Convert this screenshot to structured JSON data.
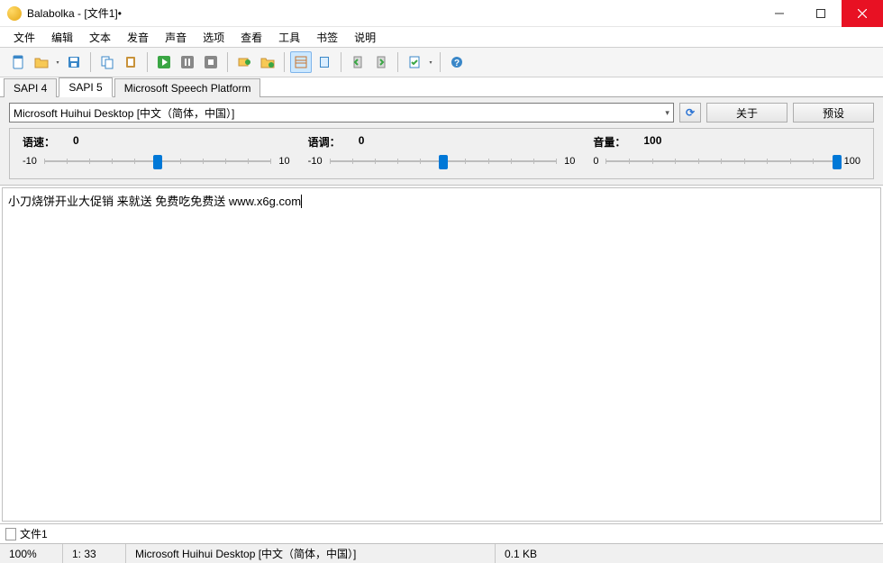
{
  "window": {
    "title": "Balabolka - [文件1]•"
  },
  "menu": [
    "文件",
    "编辑",
    "文本",
    "发音",
    "声音",
    "选项",
    "查看",
    "工具",
    "书签",
    "说明"
  ],
  "tabs": {
    "items": [
      "SAPI 4",
      "SAPI 5",
      "Microsoft Speech Platform"
    ],
    "active": 1
  },
  "voice": {
    "selected": "Microsoft Huihui Desktop [中文（简体，中国）]",
    "about_btn": "关于",
    "preset_btn": "预设"
  },
  "sliders": {
    "rate": {
      "label": "语速：",
      "value": "0",
      "min": "-10",
      "max": "10",
      "pos": 50
    },
    "pitch": {
      "label": "语调：",
      "value": "0",
      "min": "-10",
      "max": "10",
      "pos": 50
    },
    "volume": {
      "label": "音量：",
      "value": "100",
      "min": "0",
      "max": "100",
      "pos": 100
    }
  },
  "editor": {
    "text": "小刀烧饼开业大促销 来就送 免费吃免费送 www.x6g.com"
  },
  "doctab": {
    "label": "文件1"
  },
  "status": {
    "zoom": "100%",
    "pos": "1:  33",
    "voice": "Microsoft Huihui Desktop [中文（简体，中国）]",
    "size": "0.1 KB"
  }
}
